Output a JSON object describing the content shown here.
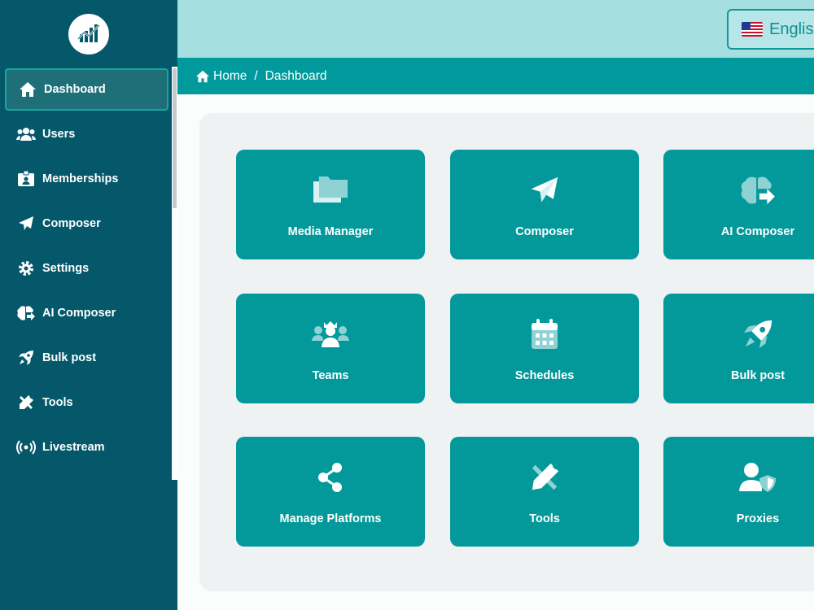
{
  "sidebar": {
    "logo_icon": "chart-logo-icon",
    "items": [
      {
        "label": "Dashboard",
        "icon": "home-icon",
        "active": true
      },
      {
        "label": "Users",
        "icon": "users-icon"
      },
      {
        "label": "Memberships",
        "icon": "id-badge-icon"
      },
      {
        "label": "Composer",
        "icon": "paper-plane-icon"
      },
      {
        "label": "Settings",
        "icon": "gear-icon"
      },
      {
        "label": "AI Composer",
        "icon": "brain-icon"
      },
      {
        "label": "Bulk post",
        "icon": "rocket-icon"
      },
      {
        "label": "Tools",
        "icon": "tools-icon"
      },
      {
        "label": "Livestream",
        "icon": "broadcast-icon"
      }
    ]
  },
  "topbar": {
    "language": "English",
    "flag_icon": "us-flag-icon"
  },
  "breadcrumb": {
    "home": "Home",
    "separator": "/",
    "current": "Dashboard"
  },
  "cards": [
    {
      "label": "Media Manager",
      "icon": "folders-icon"
    },
    {
      "label": "Composer",
      "icon": "paper-plane-icon"
    },
    {
      "label": "AI Composer",
      "icon": "brain-share-icon"
    },
    {
      "label": "Teams",
      "icon": "teams-icon"
    },
    {
      "label": "Schedules",
      "icon": "calendar-icon"
    },
    {
      "label": "Bulk post",
      "icon": "rocket-icon"
    },
    {
      "label": "Manage Platforms",
      "icon": "share-nodes-icon"
    },
    {
      "label": "Tools",
      "icon": "tools-icon"
    },
    {
      "label": "Proxies",
      "icon": "user-shield-icon"
    }
  ],
  "colors": {
    "sidebar_bg": "#05586a",
    "topbar_bg": "#a5dfe0",
    "accent": "#03999b",
    "panel_bg": "#eef2f3"
  }
}
